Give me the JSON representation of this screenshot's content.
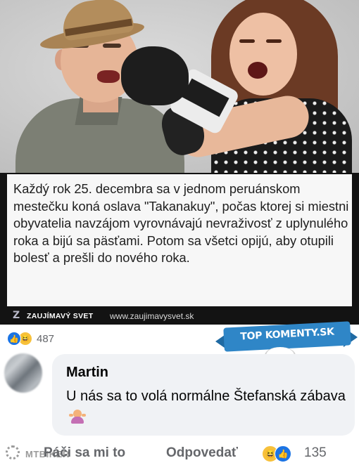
{
  "post": {
    "caption": "Každý rok 25. decembra sa v jednom peruánskom mestečku koná oslava \"Takanakuy\", počas ktorej si miestni obyvatelia navzájom vyrovnávajú nevraživosť z uplynulého roka a bijú sa päsťami. Potom sa všetci opijú, aby otupili bolesť a prešli do nového roka.",
    "brand_logo": "Z",
    "brand_name": "ZAUJÍMAVÝ SVET",
    "brand_url": "www.zaujimavysvet.sk",
    "reaction_count": "487",
    "reaction_icons": [
      "like-icon",
      "haha-icon"
    ]
  },
  "badge": {
    "text": "TOP KOMENTY.SK"
  },
  "comment": {
    "author": "Martin",
    "text": "U nás sa to volá normálne Štefanská zábava",
    "emoji": "shrug-emoji",
    "like_label": "Páči sa mi to",
    "reply_label": "Odpovedať",
    "reaction_count": "135",
    "reaction_icons": [
      "haha-icon",
      "like-icon"
    ]
  },
  "watermark": {
    "text": "MTBIKER"
  },
  "colors": {
    "facebook_blue": "#1b74e4",
    "comment_bubble": "#f0f2f5",
    "secondary_text": "#65676b",
    "ribbon_blue": "#2f86c7"
  }
}
